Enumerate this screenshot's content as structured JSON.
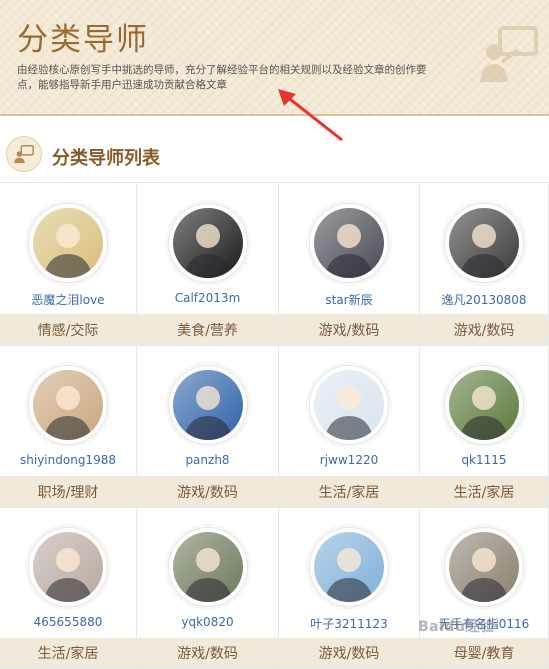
{
  "header": {
    "title": "分类导师",
    "description": "由经验核心原创写手中挑选的导师，充分了解经验平台的相关规则以及经验文章的创作要点，能够指导新手用户迅速成功贡献合格文章",
    "icon": "chat-board-icon"
  },
  "section": {
    "title": "分类导师列表",
    "icon": "mentor-chat-icon"
  },
  "mentors": [
    {
      "name": "恶魔之泪love",
      "category": "情感/交际",
      "avatar_color": "#d8c07a"
    },
    {
      "name": "Calf2013m",
      "category": "美食/营养",
      "avatar_color": "#1a1a1a"
    },
    {
      "name": "star新辰",
      "category": "游戏/数码",
      "avatar_color": "#4a4a55"
    },
    {
      "name": "逸凡20130808",
      "category": "游戏/数码",
      "avatar_color": "#3b3b3b"
    },
    {
      "name": "shiyindong1988",
      "category": "职场/理财",
      "avatar_color": "#c9a77e"
    },
    {
      "name": "panzh8",
      "category": "游戏/数码",
      "avatar_color": "#2f63a8"
    },
    {
      "name": "rjww1220",
      "category": "生活/家居",
      "avatar_color": "#d9e4f0"
    },
    {
      "name": "qk1115",
      "category": "生活/家居",
      "avatar_color": "#5a7a3a"
    },
    {
      "name": "465655880",
      "category": "生活/家居",
      "avatar_color": "#b9a8a0"
    },
    {
      "name": "yqk0820",
      "category": "游戏/数码",
      "avatar_color": "#6b7a5a"
    },
    {
      "name": "叶子3211123",
      "category": "游戏/数码",
      "avatar_color": "#7fb0d8"
    },
    {
      "name": "无手有名指0116",
      "category": "母婴/教育",
      "avatar_color": "#8a8070"
    }
  ],
  "watermark": "Baidu经验"
}
